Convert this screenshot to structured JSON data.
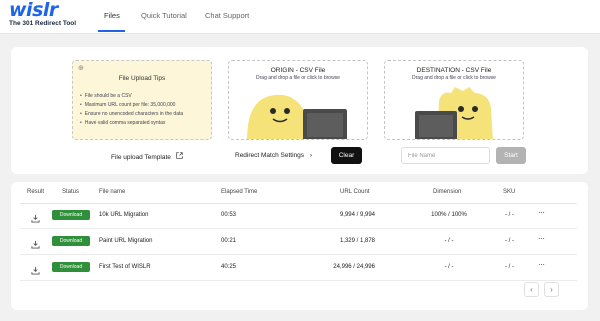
{
  "brand": {
    "logo_text": "wislr",
    "tagline": "The 301 Redirect Tool",
    "accent": "#1e64ec"
  },
  "nav": {
    "tabs": [
      {
        "label": "Files",
        "active": true
      },
      {
        "label": "Quick Tutorial",
        "active": false
      },
      {
        "label": "Chat Support",
        "active": false
      }
    ]
  },
  "upload": {
    "tips_title": "File Upload Tips",
    "tips": [
      "File should be a CSV",
      "Maximum URL count per file: 35,000,000",
      "Ensure no unencoded characters in the data",
      "Have valid comma separated syntax"
    ],
    "origin": {
      "title": "ORIGIN - CSV File",
      "subtitle": "Drag and drop a file or click to browse"
    },
    "destination": {
      "title": "DESTINATION - CSV File",
      "subtitle": "Drag and drop a file or click to browse"
    },
    "template_link": "File upload Template",
    "match_settings": "Redirect Match Settings",
    "clear_label": "Clear",
    "file_name_placeholder": "File Name",
    "start_label": "Start"
  },
  "table": {
    "headers": {
      "result": "Result",
      "status": "Status",
      "file_name": "File name",
      "elapsed": "Elapsed Time",
      "url_count": "URL Count",
      "dimension": "Dimension",
      "sku": "SKU"
    },
    "rows": [
      {
        "status": "Download",
        "file_name": "10k URL Migration",
        "elapsed": "00:53",
        "url_count": "9,994 / 9,994",
        "dimension": "100% / 100%",
        "sku": "- / -"
      },
      {
        "status": "Download",
        "file_name": "Paint URL Migration",
        "elapsed": "00:21",
        "url_count": "1,329 / 1,878",
        "dimension": "- / -",
        "sku": "- / -"
      },
      {
        "status": "Download",
        "file_name": "First Test of WISLR",
        "elapsed": "40:25",
        "url_count": "24,996 / 24,996",
        "dimension": "- / -",
        "sku": "- / -"
      }
    ],
    "status_color": "#2f8f3a"
  },
  "pagination": {
    "prev_icon": "chevron-left-icon",
    "next_icon": "chevron-right-icon"
  }
}
